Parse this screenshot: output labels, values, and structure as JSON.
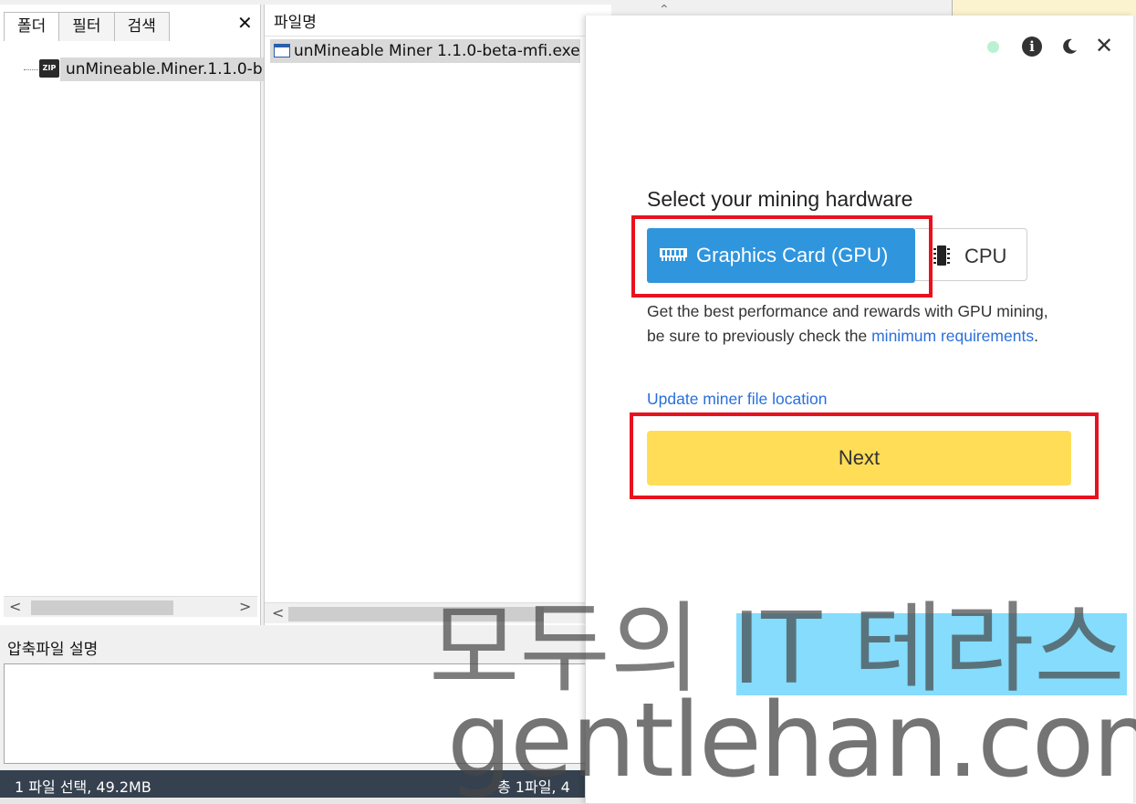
{
  "archiver": {
    "tabs": [
      "폴더",
      "필터",
      "검색"
    ],
    "close_glyph": "✕",
    "tree_item": "unMineable.Miner.1.1.0-b",
    "tree_item_icon_text": "ZIP",
    "column_header": "파일명",
    "file_item": "unMineable Miner 1.1.0-beta-mfi.exe",
    "description_label": "압축파일 설명",
    "status_left": "1 파일 선택,  49.2MB",
    "status_right": "총 1파일,  4"
  },
  "dialog": {
    "heading": "Select your mining hardware",
    "gpu_label": "Graphics Card (GPU)",
    "cpu_label": "CPU",
    "selected_option": "gpu",
    "description_before": "Get the best performance and rewards with GPU mining, be sure to previously check the ",
    "description_link": "minimum requirements",
    "description_after": ".",
    "update_link": "Update miner file location",
    "next_label": "Next",
    "close_glyph": "✕",
    "info_glyph": "i"
  },
  "watermark": {
    "line1_part1": "모두의 ",
    "line1_part2": "IT 테라스",
    "line2": "gentlehan.com"
  },
  "colors": {
    "gpu_button": "#2f95dd",
    "next_button": "#ffdd57",
    "highlight_box": "#e8121e",
    "link": "#2a6fdb",
    "status_dot": "#b9f1d2",
    "statusbar": "#35414f",
    "watermark_highlight": "#78d8fc"
  },
  "icons": [
    "zip-file-icon",
    "exe-file-icon",
    "status-dot-icon",
    "info-icon",
    "moon-icon",
    "close-icon",
    "gpu-card-icon",
    "cpu-chip-icon"
  ]
}
